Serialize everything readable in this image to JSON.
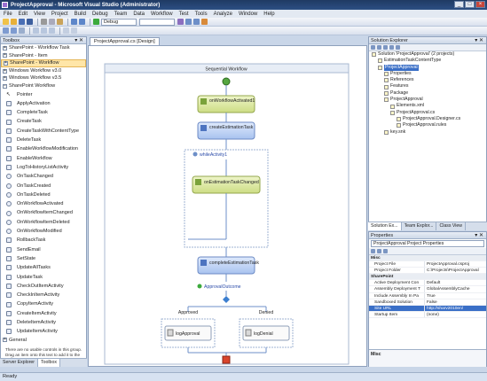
{
  "window": {
    "title": "ProjectApproval - Microsoft Visual Studio (Administrator)",
    "controls": [
      "_",
      "□",
      "×"
    ]
  },
  "menu": [
    "File",
    "Edit",
    "View",
    "Project",
    "Build",
    "Debug",
    "Team",
    "Data",
    "Workflow",
    "Test",
    "Tools",
    "Analyze",
    "Window",
    "Help"
  ],
  "toolbar": {
    "config": "Debug"
  },
  "toolbox": {
    "title": "Toolbox",
    "groups_top": [
      {
        "label": "SharePoint - Workflow Task",
        "highlight": false
      },
      {
        "label": "SharePoint - Item",
        "highlight": false
      },
      {
        "label": "SharePoint - Workflow",
        "highlight": true
      },
      {
        "label": "Windows Workflow v3.0",
        "highlight": false
      },
      {
        "label": "Windows Workflow v3.5",
        "highlight": false
      },
      {
        "label": "SharePoint Workflow",
        "highlight": false
      }
    ],
    "items": [
      "Pointer",
      "ApplyActivation",
      "CompleteTask",
      "CreateTask",
      "CreateTaskWithContentType",
      "DeleteTask",
      "EnableWorkflowModification",
      "EnableWorkflow",
      "LogToHistoryListActivity",
      "OnTaskChanged",
      "OnTaskCreated",
      "OnTaskDeleted",
      "OnWorkflowActivated",
      "OnWorkflowItemChanged",
      "OnWorkflowItemDeleted",
      "OnWorkflowModified",
      "RollbackTask",
      "SendEmail",
      "SetState",
      "UpdateAllTasks",
      "UpdateTask",
      "CheckOutItemActivity",
      "CheckInItemActivity",
      "CopyItemActivity",
      "CreateItemActivity",
      "DeleteItemActivity",
      "UpdateItemActivity"
    ],
    "group_bottom": "General",
    "note": "There are no usable controls in this group. Drag an item onto this text to add it to the toolbox.",
    "tabs": [
      "Server Explorer",
      "Toolbox"
    ]
  },
  "designer": {
    "tab": "ProjectApproval.cs [Design]",
    "title": "Sequential Workflow",
    "activities": {
      "a1": "onWorkflowActivated1",
      "a2": "createEstimationTask",
      "while": "whileActivity1",
      "a3": "onEstimationTaskChanged",
      "a4": "completeEstimationTask",
      "ifelse": "ApprovalOutcome",
      "approved": "Approved",
      "denied": "Denied",
      "log1": "logApproval",
      "log2": "logDenial"
    }
  },
  "solution_explorer": {
    "title": "Solution Explorer - Solution 'ProjectApproval' (2 projects)",
    "nodes": [
      {
        "label": "Solution 'ProjectApproval' (2 projects)",
        "indent": 0,
        "selected": false
      },
      {
        "label": "EstimationTaskContentType",
        "indent": 1,
        "selected": false
      },
      {
        "label": "ProjectApproval",
        "indent": 1,
        "selected": true
      },
      {
        "label": "Properties",
        "indent": 2,
        "selected": false
      },
      {
        "label": "References",
        "indent": 2,
        "selected": false
      },
      {
        "label": "Features",
        "indent": 2,
        "selected": false
      },
      {
        "label": "Package",
        "indent": 2,
        "selected": false
      },
      {
        "label": "ProjectApproval",
        "indent": 2,
        "selected": false
      },
      {
        "label": "Elements.xml",
        "indent": 3,
        "selected": false
      },
      {
        "label": "ProjectApproval.cs",
        "indent": 3,
        "selected": false
      },
      {
        "label": "ProjectApproval.Designer.cs",
        "indent": 4,
        "selected": false
      },
      {
        "label": "ProjectApproval.rules",
        "indent": 4,
        "selected": false
      },
      {
        "label": "key.snk",
        "indent": 2,
        "selected": false
      }
    ],
    "tabs": [
      "Solution Ex...",
      "Team Explor...",
      "Class View"
    ]
  },
  "properties": {
    "title": "Properties",
    "selector": "ProjectApproval  Project Properties",
    "rows": [
      {
        "name": "Misc",
        "value": "",
        "type": "cat"
      },
      {
        "name": "Project File",
        "value": "ProjectApproval.csproj",
        "type": "row"
      },
      {
        "name": "Project Folder",
        "value": "C:\\Projects\\ProjectApproval",
        "type": "row"
      },
      {
        "name": "SharePoint",
        "value": "",
        "type": "cat"
      },
      {
        "name": "Active Deployment Con",
        "value": "Default",
        "type": "row"
      },
      {
        "name": "Assembly Deployment T",
        "value": "GlobalAssemblyCache",
        "type": "row"
      },
      {
        "name": "Include Assembly In Pa",
        "value": "True",
        "type": "row"
      },
      {
        "name": "Sandboxed Solution",
        "value": "False",
        "type": "row"
      },
      {
        "name": "Site URL",
        "value": "http://sharv2010en/",
        "type": "sel"
      },
      {
        "name": "Startup Item",
        "value": "(none)",
        "type": "row"
      }
    ],
    "desc": "Misc"
  },
  "status": "Ready",
  "colors": {
    "activity_green": "#dbe8a8",
    "activity_blue": "#bcd2f5",
    "accent": "#3a6fc7",
    "start": "#55a641",
    "end": "#d9452c"
  }
}
